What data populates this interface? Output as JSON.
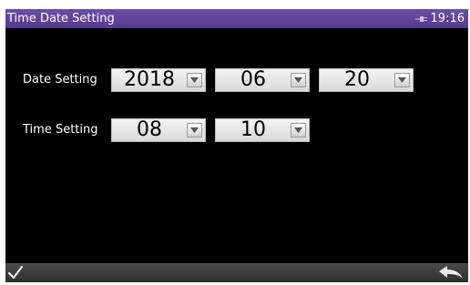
{
  "window": {
    "title": "Time Date Setting",
    "clock": "19:16",
    "status_icon": "plug-icon"
  },
  "date_setting": {
    "label": "Date Setting",
    "year": "2018",
    "month": "06",
    "day": "20"
  },
  "time_setting": {
    "label": "Time Setting",
    "hour": "08",
    "minute": "10"
  },
  "footer": {
    "ok_icon": "checkmark-icon",
    "back_icon": "back-arrow-icon"
  },
  "colors": {
    "titlebar": "#5b3f96",
    "screen_background": "#000000",
    "bottombar": "#3c3c3c"
  }
}
